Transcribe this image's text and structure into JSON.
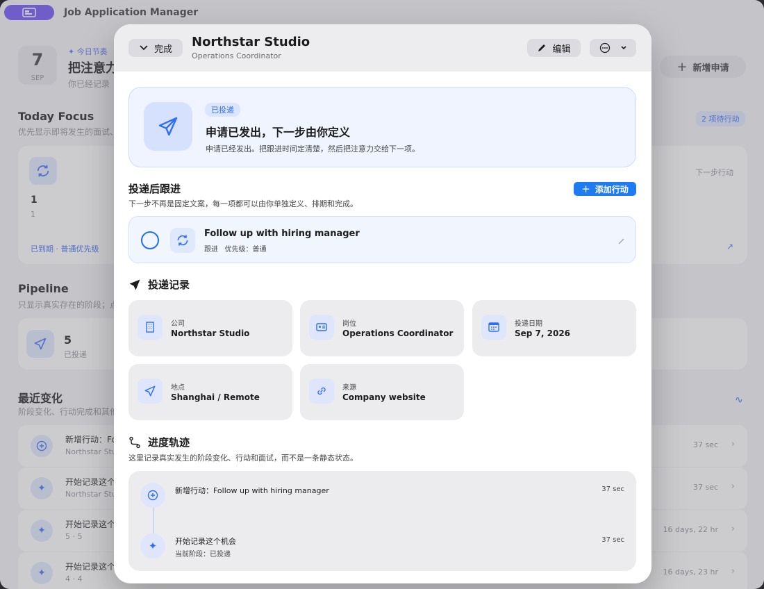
{
  "app": {
    "title": "Job Application Manager"
  },
  "background": {
    "date": {
      "day": "7",
      "month": "SEP"
    },
    "rhythm": "今日节奏",
    "headline": "把注意力",
    "subline": "你已经记录",
    "new_application": "新增申请",
    "today_focus": {
      "title": "Today Focus",
      "subtitle": "优先显示即将发生的面试、",
      "badge": "2 项待行动",
      "count": "1",
      "sub_count": "1",
      "status": "已到期 · 普通优先级",
      "next_action": "下一步行动"
    },
    "pipeline": {
      "title": "Pipeline",
      "subtitle": "只显示真实存在的阶段；点",
      "count": "5",
      "label": "已投递"
    },
    "recent": {
      "title": "最近变化",
      "subtitle": "阶段变化、行动完成和其他",
      "rows": [
        {
          "title": "新增行动：Fo",
          "sub": "Northstar Stu",
          "time": "37 sec"
        },
        {
          "title": "开始记录这个",
          "sub": "Northstar Stu",
          "time": "37 sec"
        },
        {
          "title": "开始记录这个",
          "sub": "5 · 5",
          "time": "16 days, 22 hr"
        },
        {
          "title": "开始记录这个",
          "sub": "4 · 4",
          "time": "16 days, 23 hr"
        }
      ]
    }
  },
  "modal": {
    "done": "完成",
    "title": "Northstar Studio",
    "subtitle": "Operations Coordinator",
    "edit": "编辑",
    "hero": {
      "badge": "已投递",
      "title": "申请已发出，下一步由你定义",
      "subtitle": "申请已经发出。把跟进时间定清楚，然后把注意力交给下一项。"
    },
    "followup": {
      "title": "投递后跟进",
      "subtitle": "下一步不再是固定文案，每一项都可以由你单独定义、排期和完成。",
      "add_button": "添加行动",
      "action": {
        "title": "Follow up with hiring manager",
        "type": "跟进",
        "priority": "优先级：普通"
      }
    },
    "record": {
      "title": "投递记录",
      "fields": [
        {
          "label": "公司",
          "value": "Northstar Studio",
          "icon": "building-icon"
        },
        {
          "label": "岗位",
          "value": "Operations Coordinator",
          "icon": "id-card-icon"
        },
        {
          "label": "投递日期",
          "value": "Sep 7, 2026",
          "icon": "calendar-icon"
        },
        {
          "label": "地点",
          "value": "Shanghai / Remote",
          "icon": "location-icon"
        },
        {
          "label": "来源",
          "value": "Company website",
          "icon": "link-icon"
        }
      ]
    },
    "trail": {
      "title": "进度轨迹",
      "subtitle": "这里记录真实发生的阶段变化、行动和面试，而不是一条静态状态。",
      "events": [
        {
          "title": "新增行动：Follow up with hiring manager",
          "sub": "",
          "time": "37 sec"
        },
        {
          "title": "开始记录这个机会",
          "sub": "当前阶段：已投递",
          "time": "37 sec"
        }
      ]
    }
  },
  "colors": {
    "accent": "#1e7bf2",
    "sidebar_pill": "#6b4cf6",
    "hero_bg": "#f0f4ff"
  }
}
